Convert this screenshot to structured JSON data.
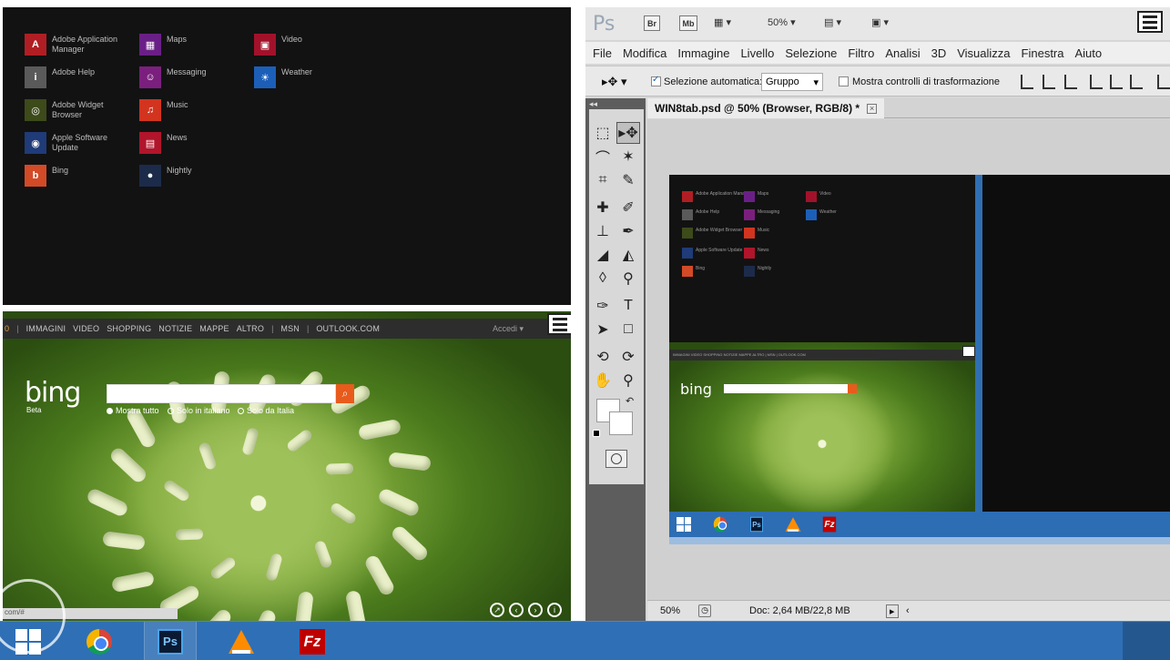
{
  "apps": [
    {
      "label": "Adobe Application Manager",
      "icon": "adobe-application-manager-icon",
      "color": "#b01e23",
      "glyph": "A"
    },
    {
      "label": "Adobe Help",
      "icon": "adobe-help-icon",
      "color": "#5a5a5a",
      "glyph": "i"
    },
    {
      "label": "Adobe Widget Browser",
      "icon": "adobe-widget-browser-icon",
      "color": "#3d4a1a",
      "glyph": "◎"
    },
    {
      "label": "Apple Software Update",
      "icon": "apple-software-update-icon",
      "color": "#1f3b78",
      "glyph": "◉"
    },
    {
      "label": "Bing",
      "icon": "bing-icon",
      "color": "#d34a27",
      "glyph": "b"
    },
    {
      "label": "Maps",
      "icon": "maps-icon",
      "color": "#6a1f86",
      "glyph": "▦"
    },
    {
      "label": "Messaging",
      "icon": "messaging-icon",
      "color": "#7b1f7e",
      "glyph": "☺"
    },
    {
      "label": "Music",
      "icon": "music-icon",
      "color": "#d2341f",
      "glyph": "♫"
    },
    {
      "label": "News",
      "icon": "news-icon",
      "color": "#b0152b",
      "glyph": "▤"
    },
    {
      "label": "Nightly",
      "icon": "nightly-icon",
      "color": "#1c2b4a",
      "glyph": "●"
    },
    {
      "label": "Video",
      "icon": "video-icon",
      "color": "#a1122a",
      "glyph": "▣"
    },
    {
      "label": "Weather",
      "icon": "weather-icon",
      "color": "#1c5fb8",
      "glyph": "☀"
    }
  ],
  "browser": {
    "nav": {
      "first": "0",
      "items": [
        "IMMAGINI",
        "VIDEO",
        "SHOPPING",
        "NOTIZIE",
        "MAPPE",
        "ALTRO"
      ],
      "msn": "MSN",
      "outlook": "OUTLOOK.COM",
      "separator": "|",
      "signin": "Accedi ▾"
    },
    "logo": "bing",
    "beta": "Beta",
    "search_placeholder": "",
    "options": [
      "Mostra tutto",
      "Solo in italiano",
      "Solo da Italia"
    ],
    "status_url": "com/#"
  },
  "photoshop": {
    "logo": "Ps",
    "chips": {
      "br": "Br",
      "mb": "Mb"
    },
    "zoom_display": "50% ▾",
    "menu": [
      "File",
      "Modifica",
      "Immagine",
      "Livello",
      "Selezione",
      "Filtro",
      "Analisi",
      "3D",
      "Visualizza",
      "Finestra",
      "Aiuto"
    ],
    "options_bar": {
      "auto_select_label": "Selezione automatica:",
      "auto_select_checked": true,
      "auto_select_value": "Gruppo",
      "transform_label": "Mostra controlli di trasformazione",
      "transform_checked": false
    },
    "document_tab": "WIN8tab.psd @ 50% (Browser, RGB/8) *",
    "status": {
      "zoom": "50%",
      "doc": "Doc: 2,64 MB/22,8 MB"
    }
  },
  "canvas_preview": {
    "apps": [
      "Adobe Application Manager",
      "Adobe Help",
      "Adobe Widget Browser",
      "Apple Software Update",
      "Bing",
      "Maps",
      "Messaging",
      "Music",
      "News",
      "Nightly",
      "Video",
      "Weather"
    ],
    "nav_text": "IMMAGINI  VIDEO  SHOPPING  NOTIZIE  MAPPE  ALTRO  |  MSN  |  OUTLOOK.COM",
    "logo": "bing"
  },
  "taskbar": {
    "items": [
      {
        "name": "start",
        "icon": "windows-logo-icon"
      },
      {
        "name": "chrome",
        "icon": "chrome-icon"
      },
      {
        "name": "photoshop",
        "icon": "photoshop-icon",
        "text": "Ps"
      },
      {
        "name": "vlc",
        "icon": "vlc-icon"
      },
      {
        "name": "filezilla",
        "icon": "filezilla-icon",
        "text": "Fz"
      }
    ]
  },
  "colors": {
    "taskbar": "#2f6fb6",
    "bing_orange": "#e85b1c",
    "start_bg": "#121212"
  }
}
